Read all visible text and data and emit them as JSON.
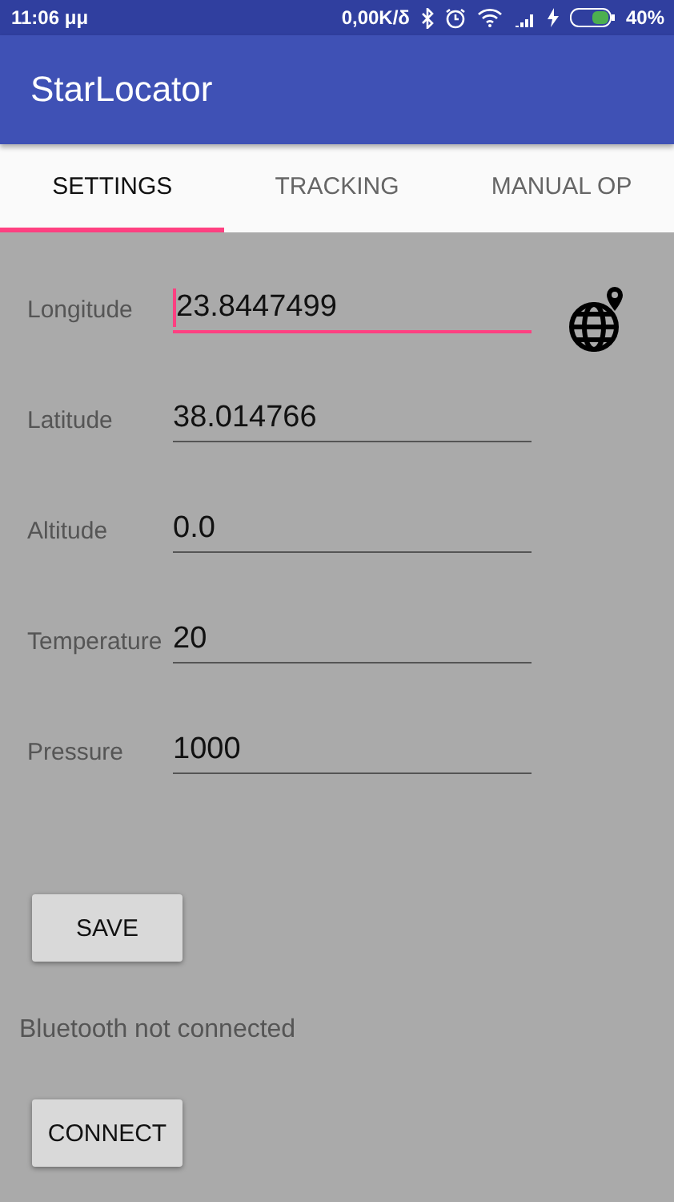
{
  "status_bar": {
    "time": "11:06 μμ",
    "speed": "0,00K/δ",
    "battery": "40%"
  },
  "app_bar": {
    "title": "StarLocator"
  },
  "tabs": [
    {
      "label": "SETTINGS",
      "selected": true
    },
    {
      "label": "TRACKING",
      "selected": false
    },
    {
      "label": "MANUAL OP",
      "selected": false
    }
  ],
  "fields": [
    {
      "label": "Longitude",
      "value": "23.8447499",
      "focused": true,
      "locate_button": true
    },
    {
      "label": "Latitude",
      "value": "38.014766",
      "focused": false,
      "locate_button": false
    },
    {
      "label": "Altitude",
      "value": "0.0",
      "focused": false,
      "locate_button": false
    },
    {
      "label": "Temperature",
      "value": "20",
      "focused": false,
      "locate_button": false
    },
    {
      "label": "Pressure",
      "value": "1000",
      "focused": false,
      "locate_button": false
    }
  ],
  "save_button": "SAVE",
  "bluetooth_status": "Bluetooth not connected",
  "connect_button": "CONNECT"
}
